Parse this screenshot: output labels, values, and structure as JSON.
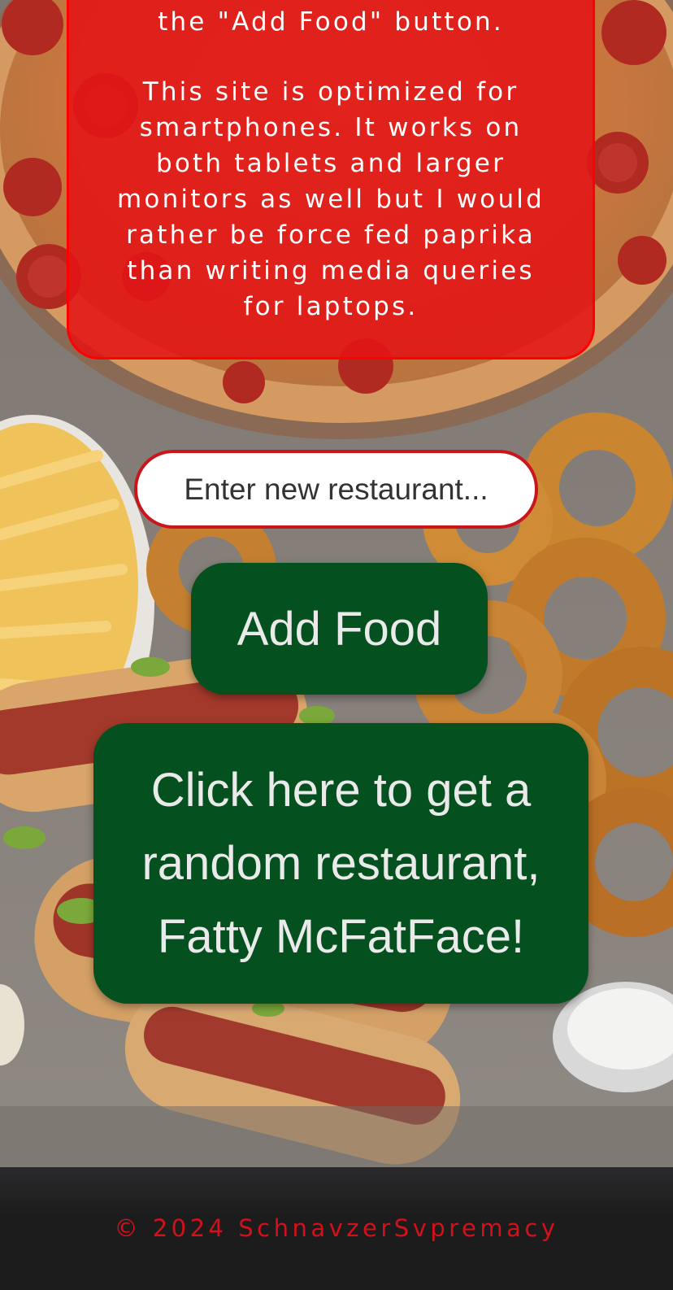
{
  "info_card": {
    "line_top": "the \"Add Food\" button.",
    "paragraph": "This site is optimized for smartphones. It works on both tablets and larger monitors as well but I would rather be force fed paprika than writing media queries for laptops."
  },
  "restaurant_input": {
    "placeholder": "Enter new restaurant...",
    "value": ""
  },
  "buttons": {
    "add_food_label": "Add Food",
    "random_label": "Click here to get a random restaurant, Fatty McFatFace!"
  },
  "footer": {
    "copyright": "© 2024 SchnavzerSvpremacy"
  },
  "colors": {
    "card_red": "#e21416",
    "card_border": "#ff0000",
    "button_green": "#04501f",
    "footer_text_red": "#d4101a",
    "footer_bg": "#1c1c1d"
  }
}
